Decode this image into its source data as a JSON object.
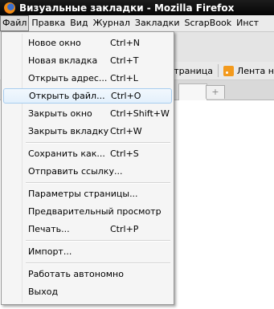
{
  "window": {
    "title": "Визуальные закладки - Mozilla Firefox"
  },
  "menubar": [
    "Файл",
    "Правка",
    "Вид",
    "Журнал",
    "Закладки",
    "ScrapBook",
    "Инст"
  ],
  "bookmarks_bar": {
    "item1": "страница",
    "item2": "Лента н"
  },
  "tabstrip": {
    "new_tab_glyph": "+"
  },
  "file_menu": {
    "items": [
      {
        "label": "Новое окно",
        "shortcut": "Ctrl+N"
      },
      {
        "label": "Новая вкладка",
        "shortcut": "Ctrl+T"
      },
      {
        "label": "Открыть адрес...",
        "shortcut": "Ctrl+L"
      },
      {
        "label": "Открыть файл...",
        "shortcut": "Ctrl+O"
      },
      {
        "label": "Закрыть окно",
        "shortcut": "Ctrl+Shift+W"
      },
      {
        "label": "Закрыть вкладку",
        "shortcut": "Ctrl+W"
      },
      {
        "label": "Сохранить как...",
        "shortcut": "Ctrl+S"
      },
      {
        "label": "Отправить ссылку...",
        "shortcut": ""
      },
      {
        "label": "Параметры страницы...",
        "shortcut": ""
      },
      {
        "label": "Предварительный просмотр",
        "shortcut": ""
      },
      {
        "label": "Печать...",
        "shortcut": "Ctrl+P"
      },
      {
        "label": "Импорт...",
        "shortcut": ""
      },
      {
        "label": "Работать автономно",
        "shortcut": ""
      },
      {
        "label": "Выход",
        "shortcut": ""
      }
    ],
    "highlighted_index": 3
  },
  "colors": {
    "titlebar": "#0a0a0a",
    "highlight_border": "#a8cdef",
    "menu_bg": "#f5f5f5"
  }
}
